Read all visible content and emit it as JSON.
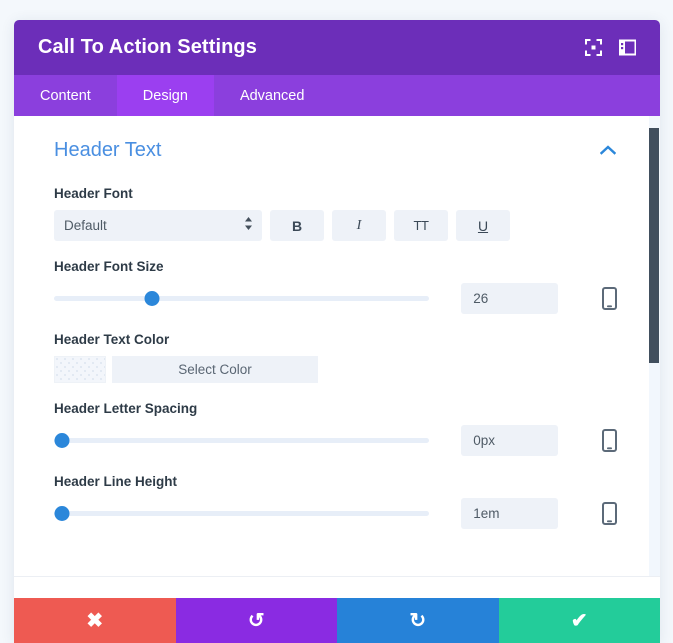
{
  "window": {
    "title": "Call To Action Settings",
    "icons": [
      {
        "name": "fullscreen-icon",
        "label": "Fullscreen"
      },
      {
        "name": "layout-panel-icon",
        "label": "Change Layout"
      }
    ]
  },
  "tabs": [
    {
      "label": "Content",
      "active": false
    },
    {
      "label": "Design",
      "active": true
    },
    {
      "label": "Advanced",
      "active": false
    }
  ],
  "section": {
    "title": "Header Text",
    "collapse_icon": "chevron-up-icon",
    "expanded": true
  },
  "fields": {
    "header_font": {
      "label": "Header Font",
      "selected": "Default",
      "buttons": [
        {
          "name": "bold-button",
          "label": "B"
        },
        {
          "name": "italic-button",
          "label": "I"
        },
        {
          "name": "uppercase-button",
          "label": "TT"
        },
        {
          "name": "underline-button",
          "label": "U"
        }
      ]
    },
    "header_font_size": {
      "label": "Header Font Size",
      "value": "26",
      "slider_percent": 26,
      "device_icon": "mobile-icon"
    },
    "header_text_color": {
      "label": "Header Text Color",
      "swatch": "transparent",
      "button_label": "Select Color"
    },
    "header_letter_spacing": {
      "label": "Header Letter Spacing",
      "value": "0px",
      "slider_percent": 1,
      "device_icon": "mobile-icon"
    },
    "header_line_height": {
      "label": "Header Line Height",
      "value": "1em",
      "slider_percent": 1,
      "device_icon": "mobile-icon"
    }
  },
  "footer": {
    "buttons": [
      {
        "name": "cancel-button",
        "glyph": "✖",
        "color": "#ee5a52"
      },
      {
        "name": "undo-button",
        "glyph": "↺",
        "color": "#8a2be2"
      },
      {
        "name": "redo-button",
        "glyph": "↻",
        "color": "#2682d8"
      },
      {
        "name": "save-button",
        "glyph": "✔",
        "color": "#23cc9a"
      }
    ]
  },
  "colors": {
    "titlebar": "#6c2eb9",
    "tabbar": "#8b3fdd",
    "tab_active": "#9b3ff0",
    "accent_blue": "#4a8fe1",
    "slider_blue": "#2b87da",
    "scrollbar_thumb": "#414f5e",
    "page_background": "#f4f8fc"
  }
}
